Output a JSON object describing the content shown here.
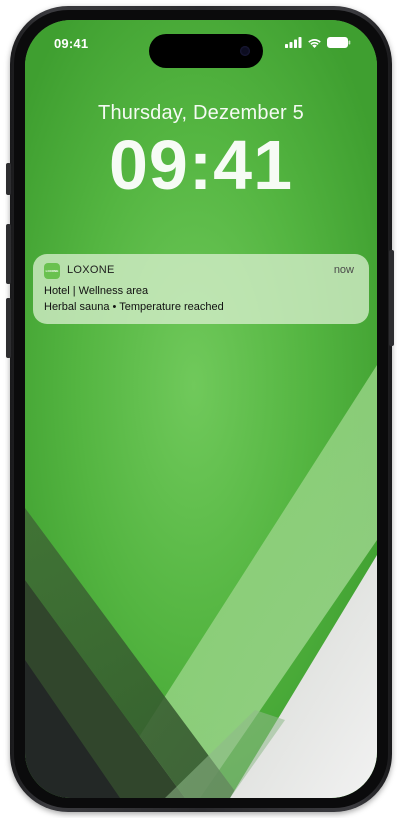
{
  "status_bar": {
    "time": "09:41"
  },
  "lock_screen": {
    "date": "Thursday, Dezember 5",
    "clock": "09:41"
  },
  "notification": {
    "app_name": "LOXONE",
    "app_icon_text": "LOXONE",
    "time": "now",
    "title": "Hotel | Wellness area",
    "body": "Herbal sauna • Temperature reached"
  },
  "colors": {
    "wallpaper_green": "#4fb33f",
    "app_icon_green": "#69c14f"
  }
}
